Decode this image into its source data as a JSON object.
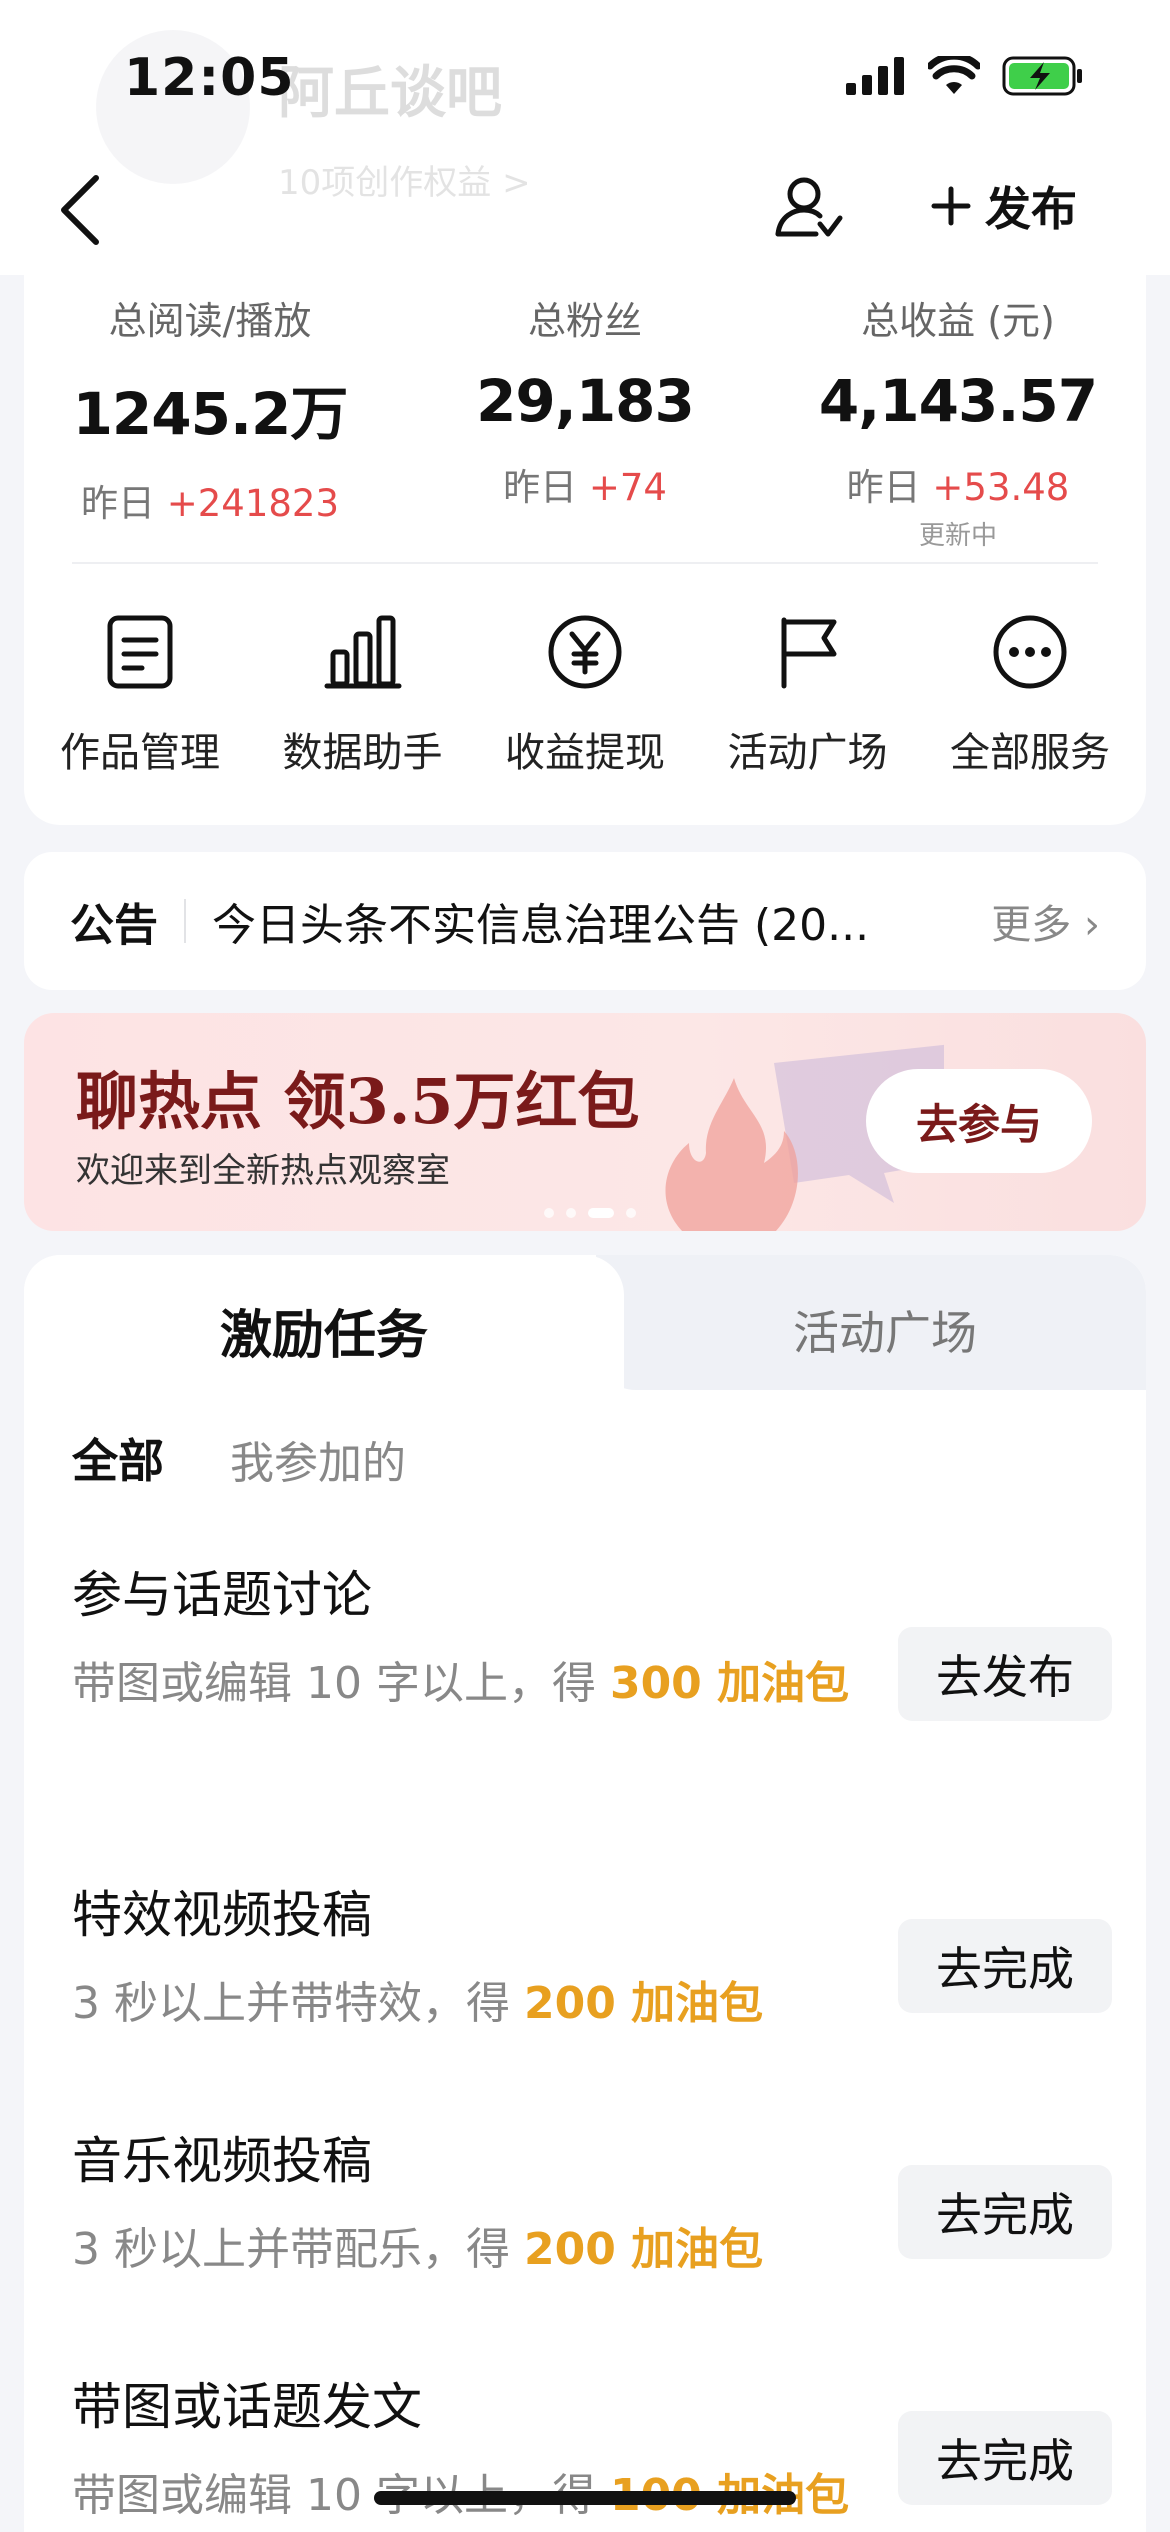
{
  "status_bar": {
    "time": "12:05"
  },
  "profile": {
    "name": "阿丘谈吧",
    "rights": "10项创作权益 >"
  },
  "nav": {
    "publish_label": "发布"
  },
  "stats": [
    {
      "label": "总阅读/播放",
      "value": "1245.2万",
      "delta_prefix": "昨日 ",
      "delta": "+241823",
      "note": ""
    },
    {
      "label": "总粉丝",
      "value": "29,183",
      "delta_prefix": "昨日 ",
      "delta": "+74",
      "note": ""
    },
    {
      "label": "总收益 (元)",
      "value": "4,143.57",
      "delta_prefix": "昨日 ",
      "delta": "+53.48",
      "note": "更新中"
    }
  ],
  "tools": [
    {
      "label": "作品管理",
      "icon": "document-icon"
    },
    {
      "label": "数据助手",
      "icon": "bar-chart-icon"
    },
    {
      "label": "收益提现",
      "icon": "yen-icon"
    },
    {
      "label": "活动广场",
      "icon": "flag-icon"
    },
    {
      "label": "全部服务",
      "icon": "more-icon"
    }
  ],
  "notice": {
    "tag": "公告",
    "text": "今日头条不实信息治理公告 (20...",
    "more": "更多"
  },
  "banner": {
    "title": "聊热点 领3.5万红包",
    "subtitle": "欢迎来到全新热点观察室",
    "button": "去参与",
    "slide_index": 3,
    "slide_count": 4
  },
  "tasks_section": {
    "tabs": [
      "激励任务",
      "活动广场"
    ],
    "filters": [
      "全部",
      "我参加的"
    ],
    "items": [
      {
        "title": "参与话题讨论",
        "desc": "带图或编辑 10 字以上，得 ",
        "reward": "300 加油包",
        "button": "去发布"
      },
      {
        "title": "特效视频投稿",
        "desc": "3 秒以上并带特效，得 ",
        "reward": "200 加油包",
        "button": "去完成"
      },
      {
        "title": "音乐视频投稿",
        "desc": "3 秒以上并带配乐，得 ",
        "reward": "200 加油包",
        "button": "去完成"
      },
      {
        "title": "带图或话题发文",
        "desc": "带图或编辑 10 字以上，得 ",
        "reward": "100 加油包",
        "button": "去完成"
      }
    ]
  },
  "colors": {
    "accent_red": "#e54b4b",
    "reward_gold": "#e8a020",
    "banner_text": "#7a1a1a"
  }
}
